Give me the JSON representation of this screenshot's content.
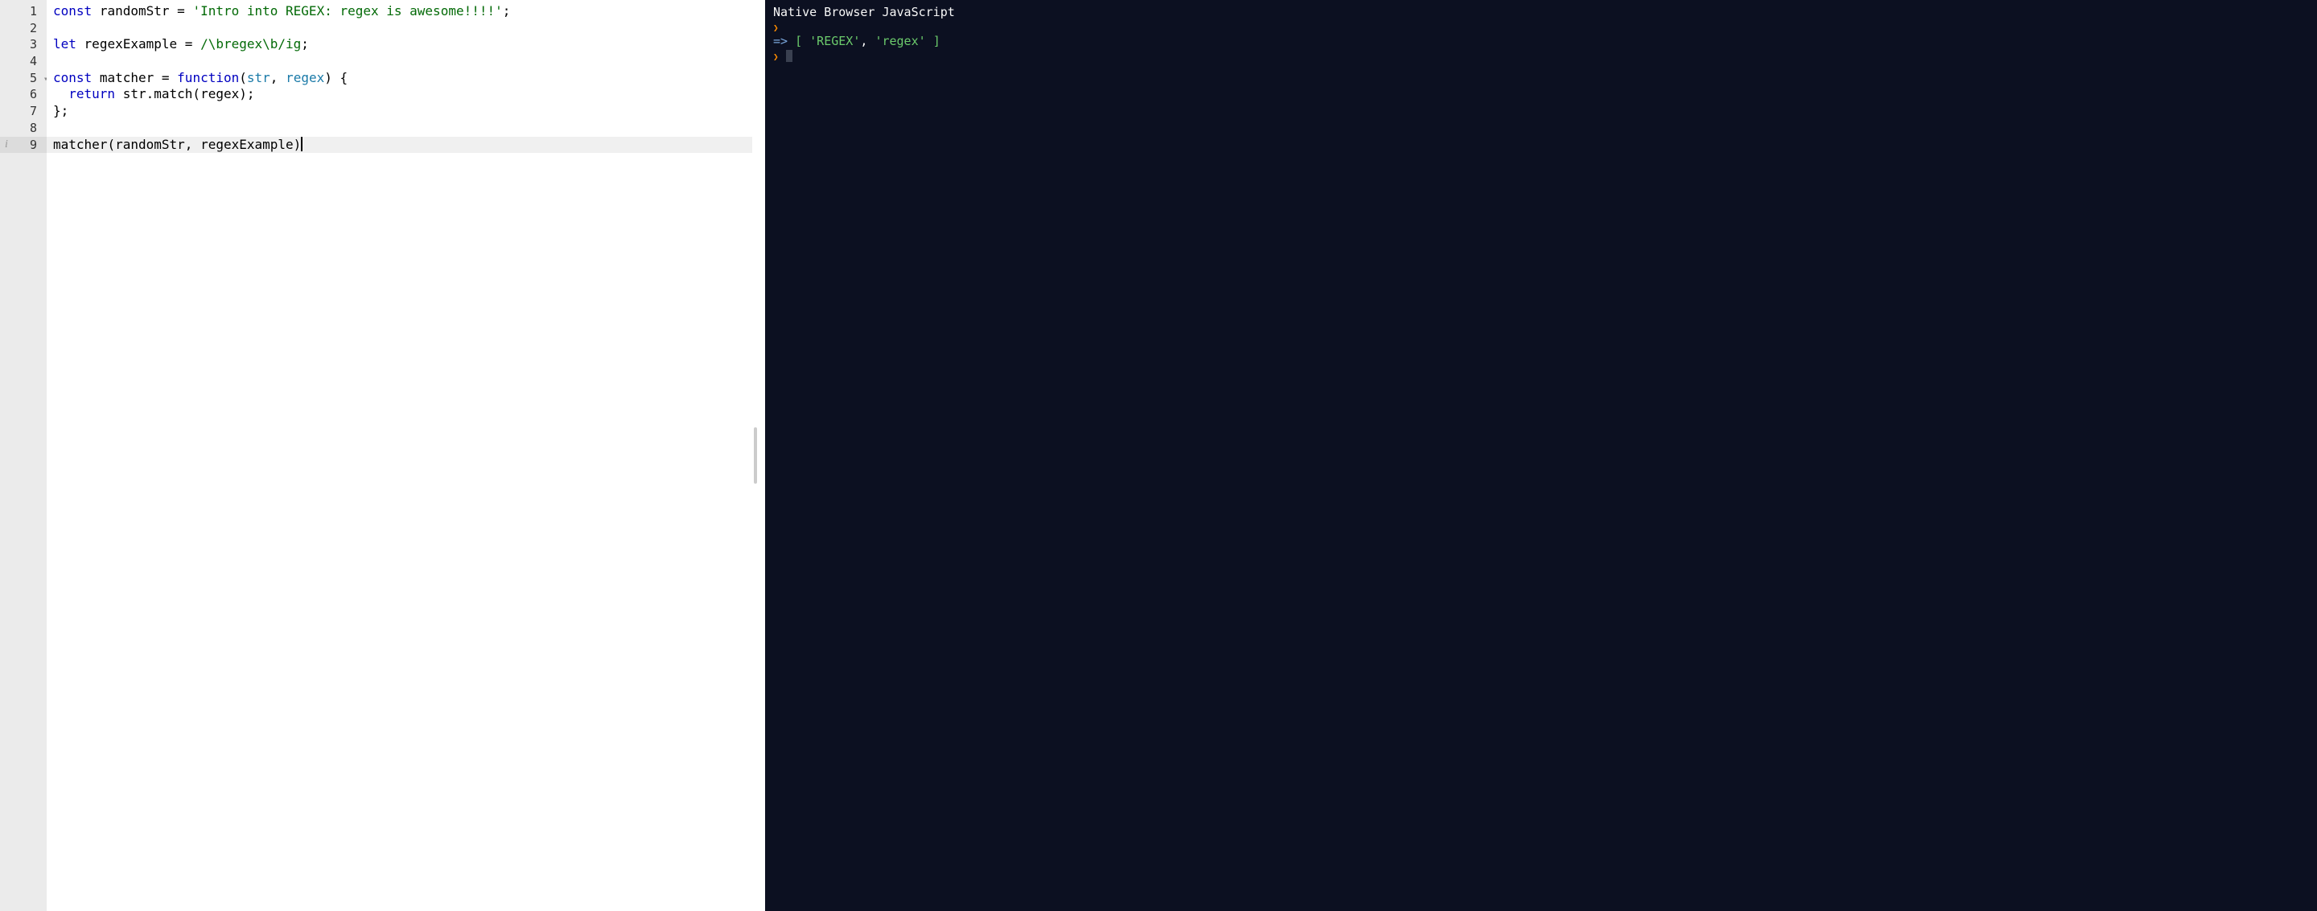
{
  "editor": {
    "lines": [
      {
        "n": "1"
      },
      {
        "n": "2"
      },
      {
        "n": "3"
      },
      {
        "n": "4"
      },
      {
        "n": "5",
        "fold": true
      },
      {
        "n": "6"
      },
      {
        "n": "7"
      },
      {
        "n": "8"
      },
      {
        "n": "9",
        "info": true,
        "active": true
      }
    ],
    "code": {
      "l1": {
        "kw1": "const",
        "sp1": " ",
        "name1": "randomStr",
        "sp2": " ",
        "op": "=",
        "sp3": " ",
        "str": "'Intro into REGEX: regex is awesome!!!!'",
        "semi": ";"
      },
      "l2": "",
      "l3": {
        "kw1": "let",
        "sp1": " ",
        "name1": "regexExample",
        "sp2": " ",
        "op": "=",
        "sp3": " ",
        "regex": "/\\bregex\\b/ig",
        "semi": ";"
      },
      "l4": "",
      "l5": {
        "kw1": "const",
        "sp1": " ",
        "name1": "matcher",
        "sp2": " ",
        "op": "=",
        "sp3": " ",
        "kw2": "function",
        "paren1": "(",
        "param1": "str",
        "comma": ",",
        "sp4": " ",
        "param2": "regex",
        "paren2": ")",
        "sp5": " ",
        "brace": "{"
      },
      "l6": {
        "indent": "  ",
        "kw1": "return",
        "sp1": " ",
        "name1": "str",
        "dot": ".",
        "method": "match",
        "paren1": "(",
        "arg": "regex",
        "paren2": ")",
        "semi": ";"
      },
      "l7": {
        "brace": "}",
        "semi": ";"
      },
      "l8": "",
      "l9": {
        "name1": "matcher",
        "paren1": "(",
        "arg1": "randomStr",
        "comma": ",",
        "sp1": " ",
        "arg2": "regexExample",
        "paren2": ")"
      }
    }
  },
  "console": {
    "title": "Native Browser JavaScript",
    "prompt_glyph": "❯",
    "result_arrow": "=>",
    "result": {
      "open": "[",
      "sp1": " ",
      "v1": "'REGEX'",
      "sep": ",",
      "sp2": " ",
      "v2": "'regex'",
      "sp3": " ",
      "close": "]"
    }
  }
}
